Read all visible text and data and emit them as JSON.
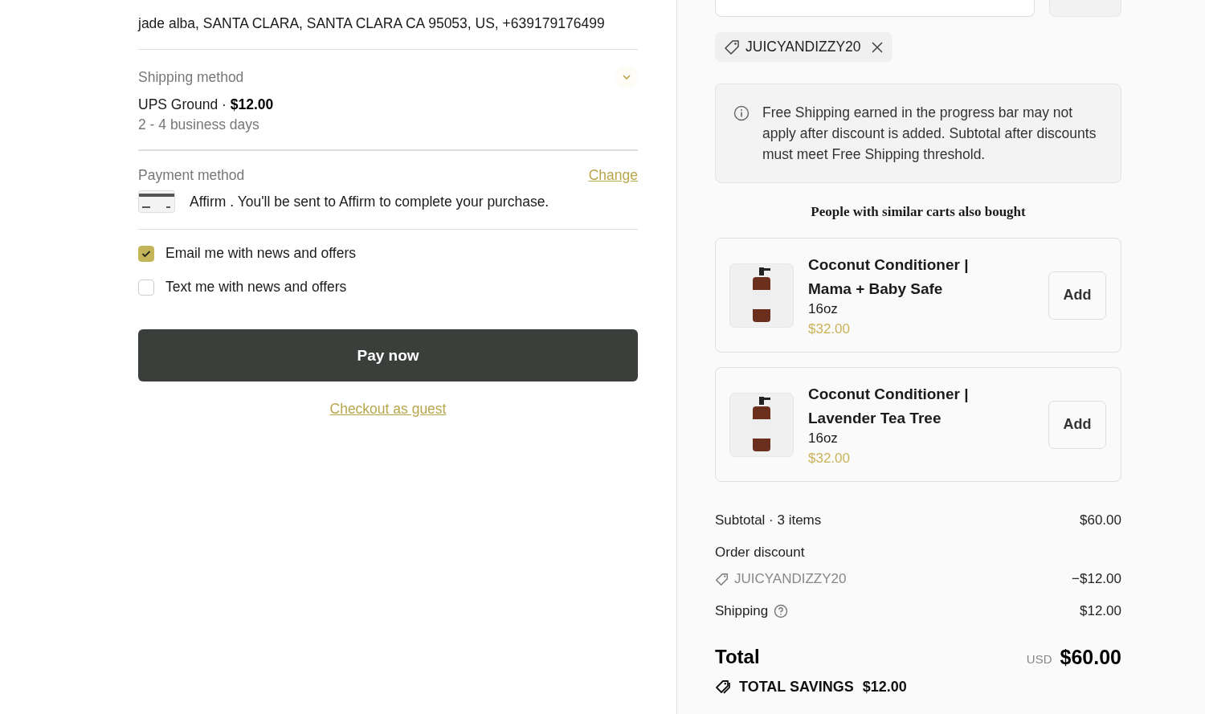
{
  "ship_to": {
    "address": "jade alba, SANTA CLARA, SANTA CLARA CA 95053, US, +639179176499"
  },
  "shipping_method": {
    "label": "Shipping method",
    "name": "UPS Ground",
    "separator": "·",
    "price": "$12.00",
    "eta": "2 - 4 business days"
  },
  "payment_method": {
    "label": "Payment method",
    "change_link": "Change",
    "description": "Affirm . You'll be sent to Affirm to complete your purchase."
  },
  "marketing_options": [
    {
      "label": "Email me with news and offers",
      "checked": true
    },
    {
      "label": "Text me with news and offers",
      "checked": false
    }
  ],
  "pay_button": "Pay now",
  "guest_link": "Checkout as guest",
  "discount_chip": {
    "code": "JUICYANDIZZY20"
  },
  "notice": "Free Shipping earned in the progress bar may not apply after discount is added. Subtotal after discounts must meet Free Shipping threshold.",
  "recommendations": {
    "title": "People with similar carts also bought",
    "products": [
      {
        "name": "Coconut Conditioner | Mama + Baby Safe",
        "size": "16oz",
        "price": "$32.00",
        "button": "Add"
      },
      {
        "name": "Coconut Conditioner | Lavender Tea Tree",
        "size": "16oz",
        "price": "$32.00",
        "button": "Add"
      }
    ]
  },
  "summary": {
    "subtotal_label": "Subtotal · 3 items",
    "subtotal": "$60.00",
    "discount_label": "Order discount",
    "discount_code": "JUICYANDIZZY20",
    "discount_amount": "−$12.00",
    "shipping_label": "Shipping",
    "shipping": "$12.00",
    "total_label": "Total",
    "currency": "USD",
    "total": "$60.00",
    "savings_label": "TOTAL SAVINGS",
    "savings": "$12.00"
  }
}
